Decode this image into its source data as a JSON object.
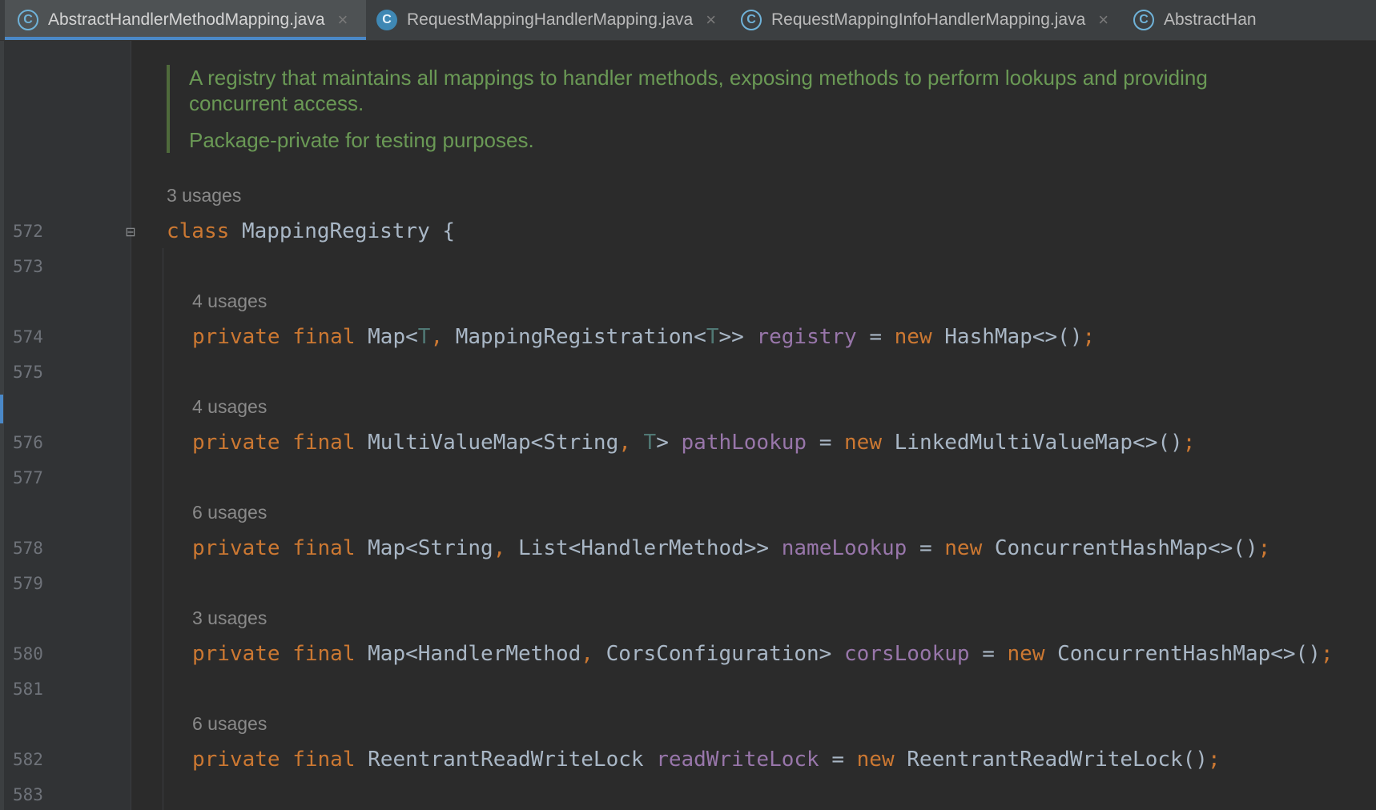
{
  "tabs": [
    {
      "label": "AbstractHandlerMethodMapping.java",
      "icon": "abstract-class-icon",
      "active": true,
      "closable": true
    },
    {
      "label": "RequestMappingHandlerMapping.java",
      "icon": "class-icon",
      "active": false,
      "closable": true
    },
    {
      "label": "RequestMappingInfoHandlerMapping.java",
      "icon": "abstract-class-icon",
      "active": false,
      "closable": true
    },
    {
      "label": "AbstractHan",
      "icon": "abstract-class-icon",
      "active": false,
      "closable": false
    }
  ],
  "icons": {
    "class_letter": "C",
    "close": "×",
    "fold": "⊟"
  },
  "javadoc": {
    "p1": "A registry that maintains all mappings to handler methods, exposing methods to perform lookups and providing concurrent access.",
    "p2": "Package-private for testing purposes."
  },
  "usages": {
    "class": "3 usages",
    "registry": "4 usages",
    "pathLookup": "4 usages",
    "nameLookup": "6 usages",
    "corsLookup": "3 usages",
    "readWriteLock": "6 usages"
  },
  "line_numbers": {
    "l572": "572",
    "l573": "573",
    "l574": "574",
    "l575": "575",
    "l576": "576",
    "l577": "577",
    "l578": "578",
    "l579": "579",
    "l580": "580",
    "l581": "581",
    "l582": "582",
    "l583": "583"
  },
  "code": {
    "l572": {
      "kw": "class",
      "name": "MappingRegistry",
      "brace": "{"
    },
    "l574": {
      "mods": "private final",
      "t1": "Map<",
      "g1": "T",
      "c1": ",",
      "t2": "MappingRegistration<",
      "g2": "T",
      "t3": ">>",
      "field": "registry",
      "eq": "=",
      "new": "new",
      "init": "HashMap<>()",
      "semi": ";"
    },
    "l576": {
      "mods": "private final",
      "t1": "MultiValueMap<String",
      "c1": ",",
      "g1": "T",
      "t2": ">",
      "field": "pathLookup",
      "eq": "=",
      "new": "new",
      "init": "LinkedMultiValueMap<>()",
      "semi": ";"
    },
    "l578": {
      "mods": "private final",
      "t1": "Map<String",
      "c1": ",",
      "t2": "List<HandlerMethod>>",
      "field": "nameLookup",
      "eq": "=",
      "new": "new",
      "init": "ConcurrentHashMap<>()",
      "semi": ";"
    },
    "l580": {
      "mods": "private final",
      "t1": "Map<HandlerMethod",
      "c1": ",",
      "t2": "CorsConfiguration>",
      "field": "corsLookup",
      "eq": "=",
      "new": "new",
      "init": "ConcurrentHashMap<>()",
      "semi": ";"
    },
    "l582": {
      "mods": "private final",
      "t1": "ReentrantReadWriteLock",
      "field": "readWriteLock",
      "eq": "=",
      "new": "new",
      "init": "ReentrantReadWriteLock()",
      "semi": ";"
    }
  }
}
